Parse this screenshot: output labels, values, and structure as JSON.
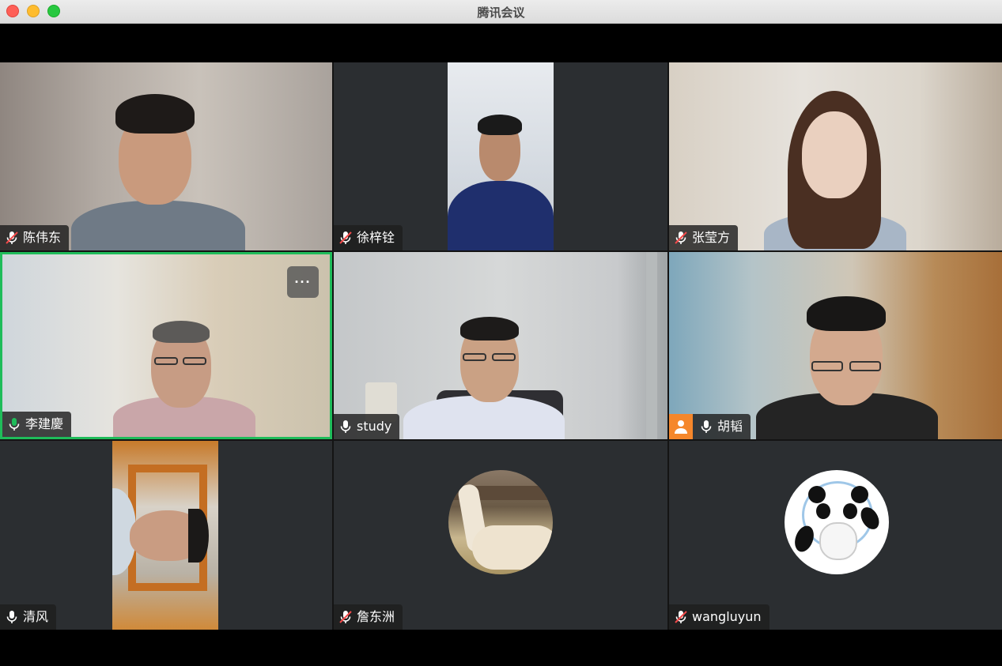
{
  "window": {
    "title": "腾讯会议"
  },
  "participants": [
    {
      "name": "陈伟东",
      "mic": "muted"
    },
    {
      "name": "徐梓铨",
      "mic": "muted"
    },
    {
      "name": "张莹方",
      "mic": "muted"
    },
    {
      "name": "李建慶",
      "mic": "speaking",
      "more_label": "···"
    },
    {
      "name": "study",
      "mic": "on"
    },
    {
      "name": "胡韬",
      "mic": "on"
    },
    {
      "name": "清风",
      "mic": "on"
    },
    {
      "name": "詹东洲",
      "mic": "muted",
      "avatar": "alpaca"
    },
    {
      "name": "wangluyun",
      "mic": "muted",
      "avatar": "panda-mascot"
    }
  ],
  "colors": {
    "active_border": "#1fbc5a",
    "speaking_mic": "#1fbc5a",
    "host_badge": "#f5872b"
  }
}
